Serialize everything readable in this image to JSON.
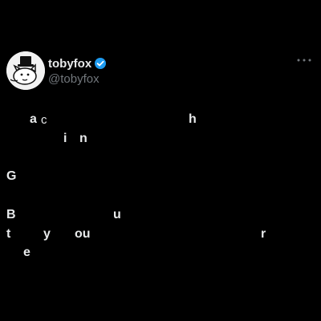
{
  "author": {
    "display_name": "tobyfox",
    "handle": "@tobyfox",
    "verified": true,
    "avatar": "dog-with-top-hat"
  },
  "actions": {
    "more_icon": "more-dots-icon"
  },
  "body_fragments": [
    "a",
    "c",
    "h",
    "i",
    "n",
    "G",
    "B",
    "u",
    "t",
    "y",
    "ou",
    "r",
    "e"
  ],
  "colors": {
    "background": "#000000",
    "text": "#e7e9ea",
    "secondary_text": "#71767b",
    "verified_badge": "#1d9bf0"
  }
}
